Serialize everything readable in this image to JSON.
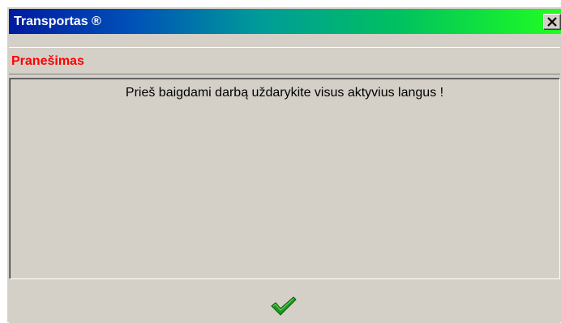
{
  "window": {
    "title": "Transportas ®",
    "close_icon": "close-icon"
  },
  "header": {
    "subtitle": "Pranešimas"
  },
  "message": {
    "text": "Prieš baigdami darbą uždarykite visus aktyvius langus !"
  },
  "footer": {
    "ok_icon": "checkmark-icon"
  },
  "colors": {
    "title_gradient_start": "#001a9e",
    "title_gradient_end": "#20ff20",
    "subtitle_text": "#ff0000",
    "checkmark": "#1e9a1e",
    "window_bg": "#d4d0c8"
  }
}
